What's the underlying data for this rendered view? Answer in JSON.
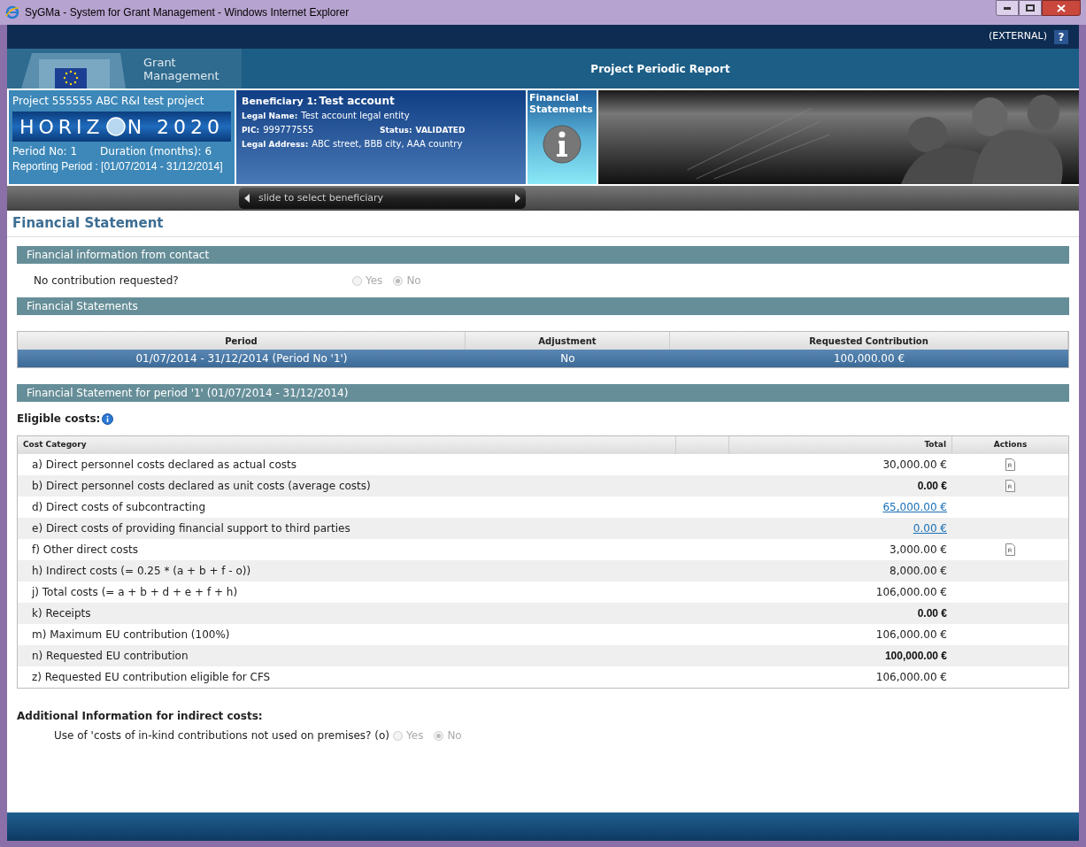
{
  "window": {
    "title": "SyGMa - System for Grant Management - Windows Internet Explorer"
  },
  "top_bar": {
    "user_role": "(EXTERNAL)",
    "help": "?"
  },
  "header": {
    "brand": [
      "Grant",
      "Management"
    ],
    "title": "Project Periodic Report"
  },
  "project": {
    "label": "Project",
    "name": "555555 ABC R&I test project",
    "logo": [
      "HORIZ",
      "N 2020"
    ],
    "period_no": "Period No: 1",
    "duration": "Duration (months): 6",
    "reporting_period": "Reporting Period : [01/07/2014 - 31/12/2014]"
  },
  "beneficiary": {
    "label": "Beneficiary 1:",
    "name": "Test account",
    "legal_name_label": "Legal Name:",
    "legal_name": "Test account legal entity",
    "pic_label": "PIC:",
    "pic": "999777555",
    "status_label": "Status:",
    "status": "VALIDATED",
    "address_label": "Legal Address:",
    "address": "ABC street, BBB city, AAA country",
    "slider": "slide to select beneficiary"
  },
  "section_tab": {
    "label": "Financial Statements"
  },
  "page_title": "Financial Statement",
  "contact_section": {
    "title": "Financial information from contact",
    "question": "No contribution requested?",
    "disabled": true,
    "options": [
      {
        "label": "Yes",
        "selected": false
      },
      {
        "label": "No",
        "selected": true
      }
    ]
  },
  "statements_section": {
    "title": "Financial Statements",
    "columns": [
      "Period",
      "Adjustment",
      "Requested Contribution"
    ],
    "rows": [
      {
        "cells": [
          "01/07/2014 - 31/12/2014 (Period No '1')",
          "No",
          "100,000.00 €"
        ],
        "selected": true
      }
    ]
  },
  "period_section": {
    "title": "Financial Statement for period '1' (01/07/2014 - 31/12/2014)",
    "eligible_label": "Eligible costs:",
    "columns": [
      "Cost Category",
      "Total",
      "Actions"
    ],
    "rows": [
      {
        "category": "a) Direct personnel costs declared as actual costs",
        "total": "30,000.00 €",
        "kind": "plain",
        "report": true
      },
      {
        "category": "b) Direct personnel costs declared as unit costs (average costs)",
        "total": "0.00 €",
        "kind": "bold",
        "report": true
      },
      {
        "category": "d) Direct costs of subcontracting",
        "total": "65,000.00 €",
        "kind": "link",
        "report": false
      },
      {
        "category": "e) Direct costs of providing financial support to third parties",
        "total": "0.00 €",
        "kind": "link",
        "report": false
      },
      {
        "category": "f) Other direct costs",
        "total": "3,000.00 €",
        "kind": "plain",
        "report": true
      },
      {
        "category": "h) Indirect costs (= 0.25 * (a + b + f - o))",
        "total": "8,000.00 €",
        "kind": "plain",
        "report": false
      },
      {
        "category": "j) Total costs (= a + b + d + e + f + h)",
        "total": "106,000.00 €",
        "kind": "plain",
        "report": false
      },
      {
        "category": "k) Receipts",
        "total": "0.00 €",
        "kind": "bold",
        "report": false
      },
      {
        "category": "m) Maximum EU contribution (100%)",
        "total": "106,000.00 €",
        "kind": "plain",
        "report": false
      },
      {
        "category": "n) Requested EU contribution",
        "total": "100,000.00 €",
        "kind": "bold",
        "report": false
      },
      {
        "category": "z) Requested EU contribution eligible for CFS",
        "total": "106,000.00 €",
        "kind": "plain",
        "report": false
      }
    ]
  },
  "additional": {
    "title": "Additional Information for indirect costs:",
    "question": "Use of 'costs of in-kind contributions not used on premises? (o)",
    "disabled": true,
    "options": [
      {
        "label": "Yes",
        "selected": false
      },
      {
        "label": "No",
        "selected": true
      }
    ]
  }
}
